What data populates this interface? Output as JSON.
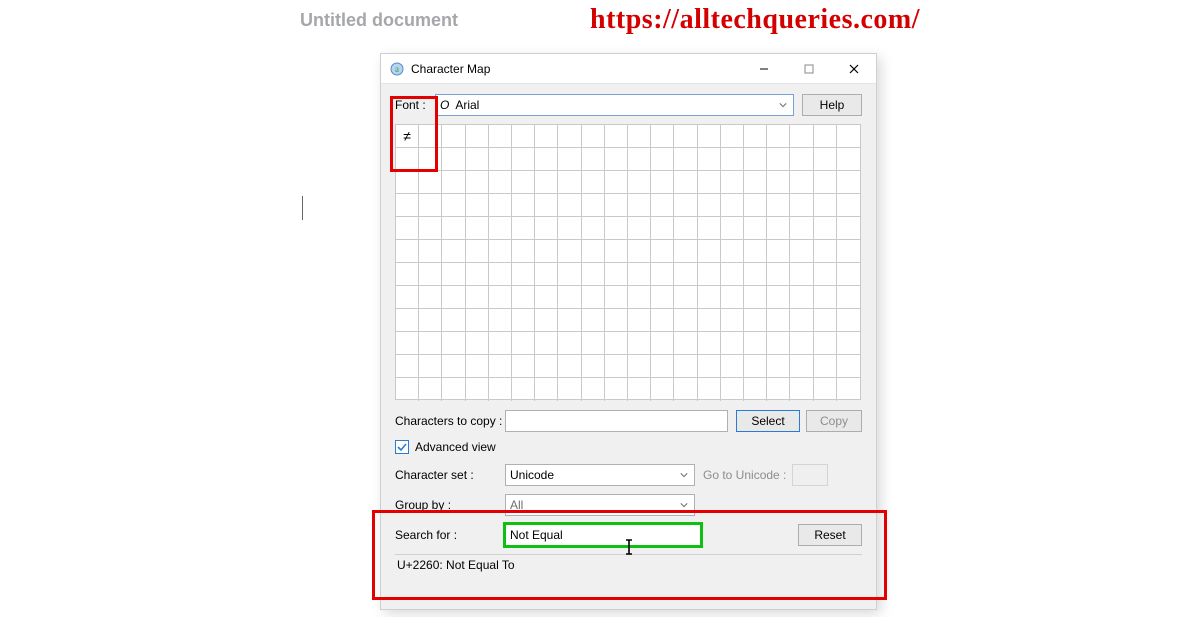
{
  "page": {
    "doc_title": "Untitled document",
    "watermark": "https://alltechqueries.com/"
  },
  "window": {
    "title": "Character Map",
    "font_label": "Font :",
    "font_value": "Arial",
    "font_italic_o": "O",
    "help_label": "Help",
    "grid_char": "≠",
    "copy_label": "Characters to copy :",
    "copy_value": "",
    "select_label": "Select",
    "copy_button_label": "Copy",
    "advanced_label": "Advanced view",
    "advanced_checked": true,
    "charset_label": "Character set :",
    "charset_value": "Unicode",
    "goto_label": "Go to Unicode :",
    "group_label": "Group by :",
    "group_value": "All",
    "search_label": "Search for :",
    "search_value": "Not Equal",
    "reset_label": "Reset",
    "info_text": "U+2260: Not Equal To"
  }
}
